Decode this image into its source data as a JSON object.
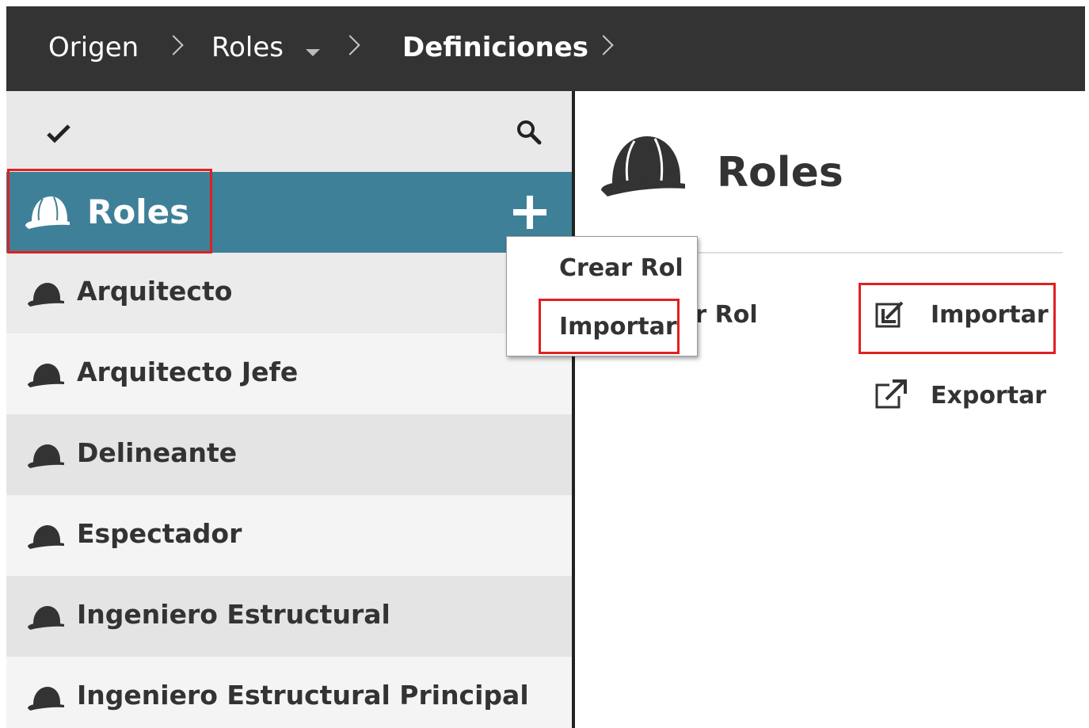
{
  "breadcrumb": {
    "items": [
      {
        "label": "Origen"
      },
      {
        "label": "Roles"
      },
      {
        "label": "Definiciones"
      }
    ]
  },
  "sidebar": {
    "header": {
      "title": "Roles"
    },
    "items": [
      {
        "label": "Arquitecto"
      },
      {
        "label": "Arquitecto Jefe"
      },
      {
        "label": "Delineante"
      },
      {
        "label": "Espectador"
      },
      {
        "label": "Ingeniero Estructural"
      },
      {
        "label": "Ingeniero Estructural Principal"
      }
    ]
  },
  "dropdown": {
    "items": [
      {
        "label": "Crear Rol"
      },
      {
        "label": "Importar"
      }
    ]
  },
  "main": {
    "title": "Roles",
    "actions": {
      "create_label": "Crear Rol",
      "import_label": "Importar",
      "export_label": "Exportar"
    }
  },
  "colors": {
    "topbar": "#333333",
    "selected_header": "#3f8099",
    "highlight": "#e02020"
  }
}
